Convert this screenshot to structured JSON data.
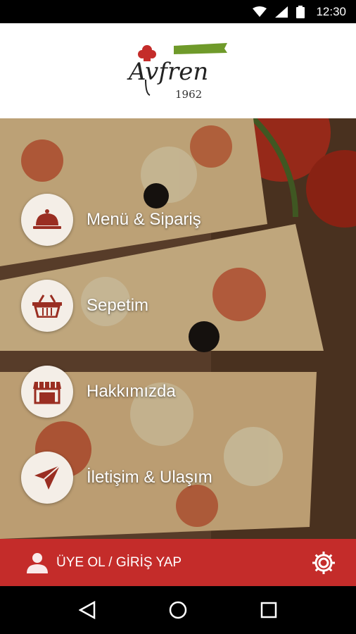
{
  "status_bar": {
    "time": "12:30"
  },
  "brand": {
    "name": "Avfren",
    "year": "1962",
    "ribbon": "since 1962"
  },
  "menu": [
    {
      "id": "menu-order",
      "label": "Menü & Sipariş",
      "icon": "cloche-icon"
    },
    {
      "id": "cart",
      "label": "Sepetim",
      "icon": "basket-icon"
    },
    {
      "id": "about",
      "label": "Hakkımızda",
      "icon": "store-icon"
    },
    {
      "id": "contact",
      "label": "İletişim & Ulaşım",
      "icon": "paper-plane-icon"
    }
  ],
  "footer": {
    "login_label": "ÜYE OL / GİRİŞ YAP"
  },
  "colors": {
    "accent": "#c42c2a",
    "circle": "#f4eee7",
    "icon": "#9a2e22"
  }
}
